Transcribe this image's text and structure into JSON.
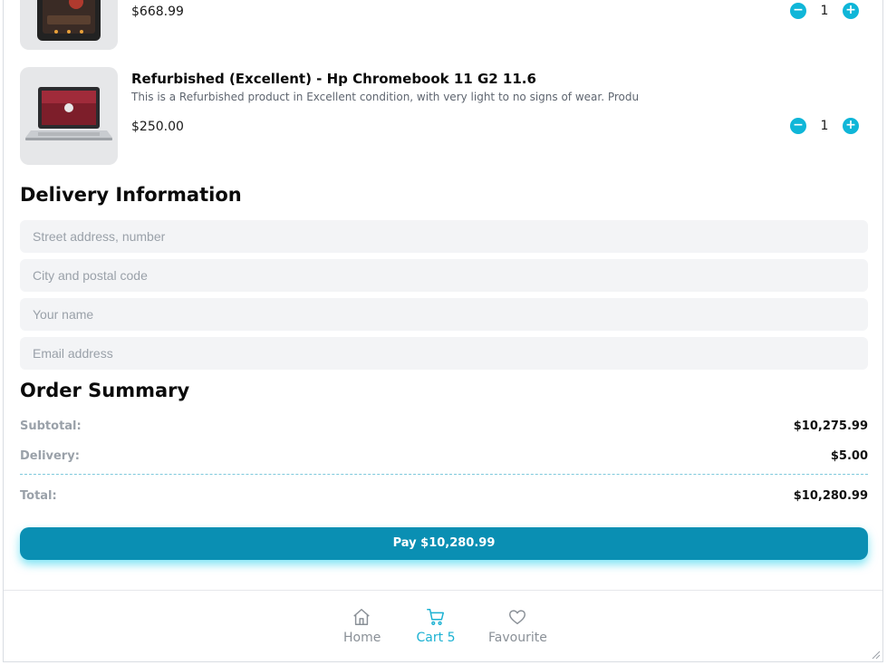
{
  "cart": {
    "items": [
      {
        "title": "",
        "description": "",
        "price": "$668.99",
        "quantity": "1",
        "image_icon": "phone-image"
      },
      {
        "title": "Refurbished (Excellent) - Hp Chromebook 11 G2 11.6",
        "description": "This is a Refurbished product in Excellent condition, with very light to no signs of wear. Product h...",
        "price": "$250.00",
        "quantity": "1",
        "image_icon": "laptop-image"
      }
    ],
    "minus_icon": "minus-icon",
    "plus_icon": "plus-icon"
  },
  "delivery": {
    "title": "Delivery Information",
    "street_placeholder": "Street address, number",
    "city_placeholder": "City and postal code",
    "name_placeholder": "Your name",
    "email_placeholder": "Email address"
  },
  "summary": {
    "title": "Order Summary",
    "subtotal_label": "Subtotal:",
    "subtotal_value": "$10,275.99",
    "delivery_label": "Delivery:",
    "delivery_value": "$5.00",
    "total_label": "Total:",
    "total_value": "$10,280.99"
  },
  "pay_button": "Pay $10,280.99",
  "nav": {
    "items": [
      {
        "label": "Home",
        "icon": "home-icon",
        "active": false
      },
      {
        "label": "Cart 5",
        "icon": "cart-icon",
        "active": true
      },
      {
        "label": "Favourite",
        "icon": "heart-icon",
        "active": false
      }
    ]
  },
  "colors": {
    "accent": "#0fb6d8",
    "pay_button": "#0a8fb3",
    "active_nav": "#1bb1d2",
    "field_bg": "#f3f4f6"
  }
}
